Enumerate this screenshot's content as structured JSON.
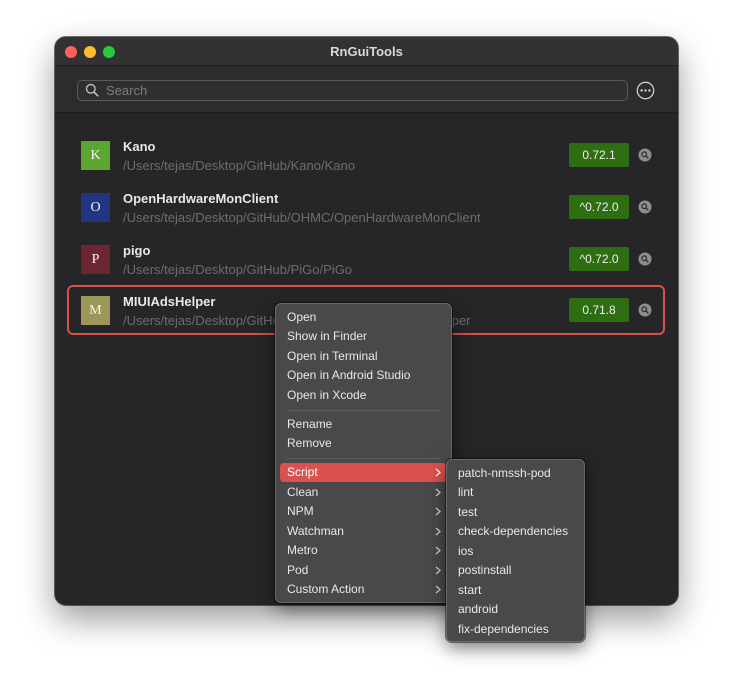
{
  "window": {
    "title": "RnGuiTools"
  },
  "search": {
    "placeholder": "Search",
    "value": ""
  },
  "projects": [
    {
      "initial": "K",
      "name": "Kano",
      "path": "/Users/tejas/Desktop/GitHub/Kano/Kano",
      "version": "0.72.1",
      "color": "#5ba62e"
    },
    {
      "initial": "O",
      "name": "OpenHardwareMonClient",
      "path": "/Users/tejas/Desktop/GitHub/OHMC/OpenHardwareMonClient",
      "version": "^0.72.0",
      "color": "#233580"
    },
    {
      "initial": "P",
      "name": "pigo",
      "path": "/Users/tejas/Desktop/GitHub/PiGo/PiGo",
      "version": "^0.72.0",
      "color": "#6b2632"
    },
    {
      "initial": "M",
      "name": "MIUIAdsHelper",
      "path": "/Users/tejas/Desktop/GitHub/MIUIAdsHelper/MIUIAdsHelper",
      "version": "0.71.8",
      "color": "#9c9658"
    }
  ],
  "selected_project": "MIUIAdsHelper",
  "context_menu": {
    "items": [
      {
        "label": "Open",
        "submenu": false
      },
      {
        "label": "Show in Finder",
        "submenu": false
      },
      {
        "label": "Open in Terminal",
        "submenu": false
      },
      {
        "label": "Open in Android Studio",
        "submenu": false
      },
      {
        "label": "Open in Xcode",
        "submenu": false
      },
      {
        "label": "Rename",
        "submenu": false
      },
      {
        "label": "Remove",
        "submenu": false
      },
      {
        "label": "Script",
        "submenu": true,
        "active": true
      },
      {
        "label": "Clean",
        "submenu": true
      },
      {
        "label": "NPM",
        "submenu": true
      },
      {
        "label": "Watchman",
        "submenu": true
      },
      {
        "label": "Metro",
        "submenu": true
      },
      {
        "label": "Pod",
        "submenu": true
      },
      {
        "label": "Custom Action",
        "submenu": true
      }
    ]
  },
  "script_submenu": {
    "items": [
      "patch-nmssh-pod",
      "lint",
      "test",
      "check-dependencies",
      "ios",
      "postinstall",
      "start",
      "android",
      "fix-dependencies"
    ]
  },
  "colors": {
    "accent": "#d9524f",
    "version_badge": "#2e6d12",
    "window_bg": "#262628"
  },
  "icons": {
    "search": "search-icon",
    "more": "ellipsis-circle-icon",
    "row_action": "magnifier-icon",
    "submenu": "chevron-right-icon"
  }
}
